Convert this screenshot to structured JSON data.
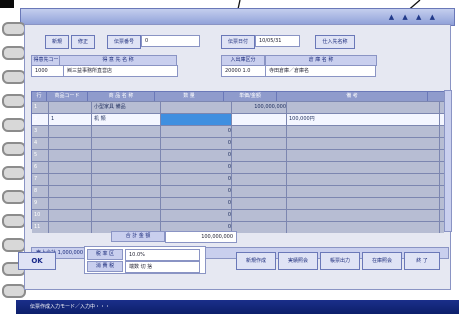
{
  "window": {
    "title_dots": "▲ ▲ ▲ ▲"
  },
  "toolbar": {
    "new_label": "新規",
    "edit_label": "修正",
    "copy_label": "伝票番号",
    "field1_value": "0",
    "date_label": "伝票日付",
    "date_value": "10/05/31",
    "client_label": "仕入先名称"
  },
  "header": {
    "code_label": "得意先コード",
    "name_label": "得 意 先 名 称",
    "code_value": "1000",
    "name_value": "㈱三益事務所直営店",
    "shipping_label": "入出庫区分",
    "warehouse_label": "倉 庫 名 称",
    "shipping_value": "20000 1.0",
    "warehouse_value": "寺田倉庫／倉庫名"
  },
  "grid": {
    "columns": [
      "行",
      "商品コード",
      "商 品 名 称",
      "数 量",
      "単価/金額",
      "備 考"
    ],
    "rows": [
      {
        "no": "1",
        "code": "",
        "name": "小型家具 備品",
        "qty": "",
        "amount": "100,000,000",
        "note": ""
      },
      {
        "no": "2",
        "code": "1",
        "name": "机 類",
        "qty": "",
        "amount": "",
        "note": "100,000円"
      },
      {
        "no": "3",
        "code": "",
        "name": "",
        "qty": "0",
        "amount": "",
        "note": ""
      },
      {
        "no": "4",
        "code": "",
        "name": "",
        "qty": "0",
        "amount": "",
        "note": ""
      },
      {
        "no": "5",
        "code": "",
        "name": "",
        "qty": "0",
        "amount": "",
        "note": ""
      },
      {
        "no": "6",
        "code": "",
        "name": "",
        "qty": "0",
        "amount": "",
        "note": ""
      },
      {
        "no": "7",
        "code": "",
        "name": "",
        "qty": "0",
        "amount": "",
        "note": ""
      },
      {
        "no": "8",
        "code": "",
        "name": "",
        "qty": "0",
        "amount": "",
        "note": ""
      },
      {
        "no": "9",
        "code": "",
        "name": "",
        "qty": "0",
        "amount": "",
        "note": ""
      },
      {
        "no": "10",
        "code": "",
        "name": "",
        "qty": "0",
        "amount": "",
        "note": ""
      },
      {
        "no": "11",
        "code": "",
        "name": "",
        "qty": "0",
        "amount": "",
        "note": ""
      }
    ]
  },
  "totals": {
    "label": "合 計 金 額",
    "value": "100,000,000"
  },
  "footer_strip": "売上合計  1,000,000  税込合計  粗利益  消費税  合計数量",
  "ok_label": "OK",
  "info": {
    "label1": "税 率 区",
    "value1": "10.0%",
    "label2": "消 費 税",
    "value2": "端数 切 捨"
  },
  "actions": [
    "新規作成",
    "実績照会",
    "帳票出力",
    "在庫照会",
    "終 了"
  ],
  "status_text": "伝票作成入力モード／入力中・・・"
}
